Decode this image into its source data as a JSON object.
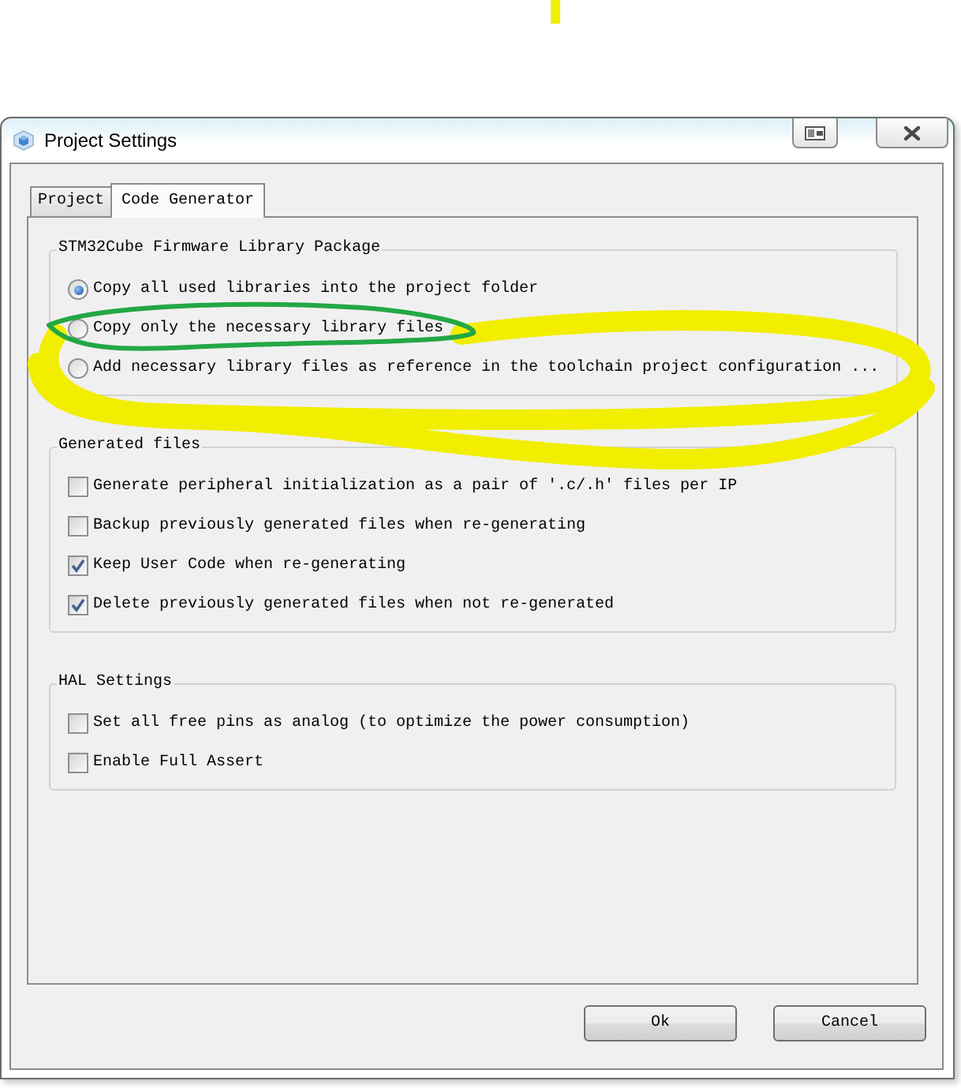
{
  "window": {
    "title": "Project Settings"
  },
  "tabs": [
    {
      "label": "Project",
      "selected": false
    },
    {
      "label": "Code Generator",
      "selected": true
    }
  ],
  "groups": [
    {
      "title": "STM32Cube Firmware Library Package",
      "options": [
        {
          "kind": "radio",
          "label": "Copy all used libraries into the project folder",
          "selected": true
        },
        {
          "kind": "radio",
          "label": "Copy only the necessary library files",
          "selected": false
        },
        {
          "kind": "radio",
          "label": "Add necessary library files as reference in the toolchain project configuration ...",
          "selected": false
        }
      ]
    },
    {
      "title": "Generated files",
      "options": [
        {
          "kind": "checkbox",
          "label": "Generate peripheral initialization as a pair of '.c/.h' files per IP",
          "checked": false
        },
        {
          "kind": "checkbox",
          "label": "Backup previously generated files when re-generating",
          "checked": false
        },
        {
          "kind": "checkbox",
          "label": "Keep User Code when re-generating",
          "checked": true
        },
        {
          "kind": "checkbox",
          "label": "Delete previously generated files when not re-generated",
          "checked": true
        }
      ]
    },
    {
      "title": "HAL Settings",
      "options": [
        {
          "kind": "checkbox",
          "label": "Set all free pins as analog (to optimize the power consumption)",
          "checked": false
        },
        {
          "kind": "checkbox",
          "label": "Enable Full Assert",
          "checked": false
        }
      ]
    }
  ],
  "buttons": [
    "Ok",
    "Cancel"
  ],
  "annotations": [
    {
      "kind": "stroke",
      "color": "#f2ee00"
    },
    {
      "kind": "scribble",
      "color": "#f2ee00"
    },
    {
      "kind": "loop",
      "color": "#22a845"
    }
  ]
}
